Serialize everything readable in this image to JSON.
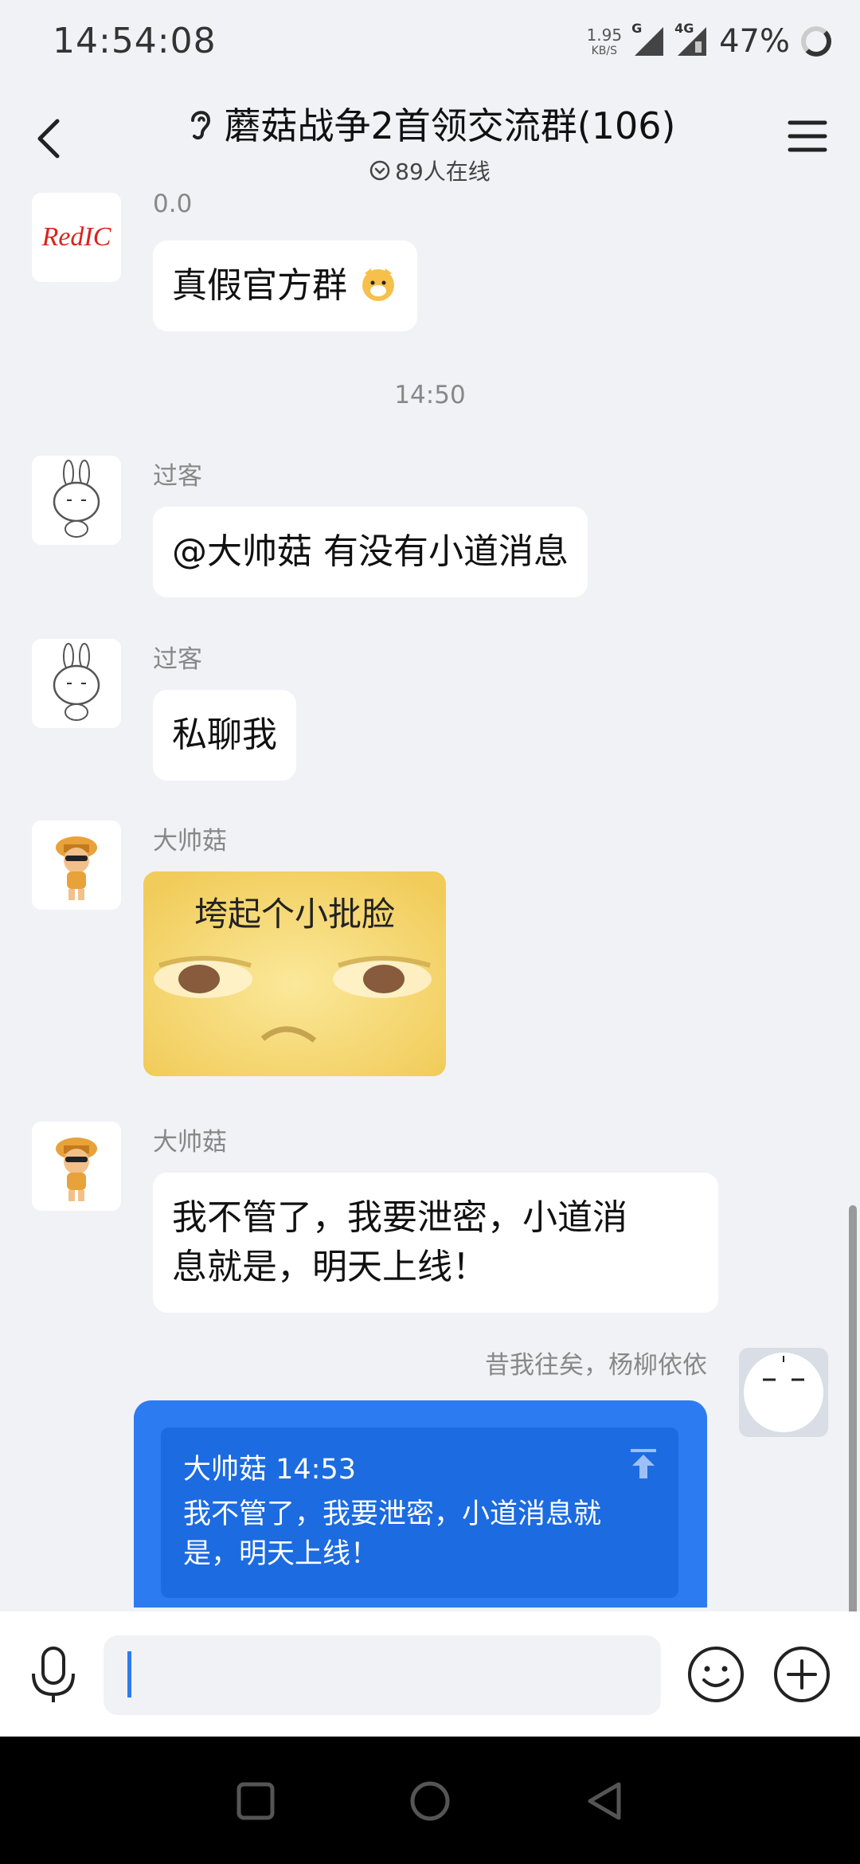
{
  "status_bar": {
    "time": "14:54:08",
    "net_speed_value": "1.95",
    "net_speed_unit": "KB/S",
    "signal1_label": "G",
    "signal2_label": "4G",
    "battery": "47%"
  },
  "header": {
    "title": "蘑菇战争2首领交流群(106)",
    "online": "89人在线"
  },
  "messages": [
    {
      "sender": "0.0",
      "text": "真假官方群",
      "avatar_label": "RedIC"
    },
    {
      "time_separator": "14:50"
    },
    {
      "sender": "过客",
      "text": "@大帅菇 有没有小道消息"
    },
    {
      "sender": "过客",
      "text": "私聊我"
    },
    {
      "sender": "大帅菇",
      "sticker_text": "垮起个小批脸"
    },
    {
      "sender": "大帅菇",
      "text_line1": "我不管了，我要泄密，小道消",
      "text_line2": "息就是，明天上线！"
    },
    {
      "self_name": "昔我往矣，杨柳依依",
      "quote_head": "大帅菇 14:53",
      "quote_body": "我不管了，我要泄密，小道消息就是，明天上线！"
    }
  ],
  "colors": {
    "accent_blue": "#2d7bf1",
    "chat_bg": "#f1f2f6",
    "quote_blue": "#1c6be0"
  }
}
